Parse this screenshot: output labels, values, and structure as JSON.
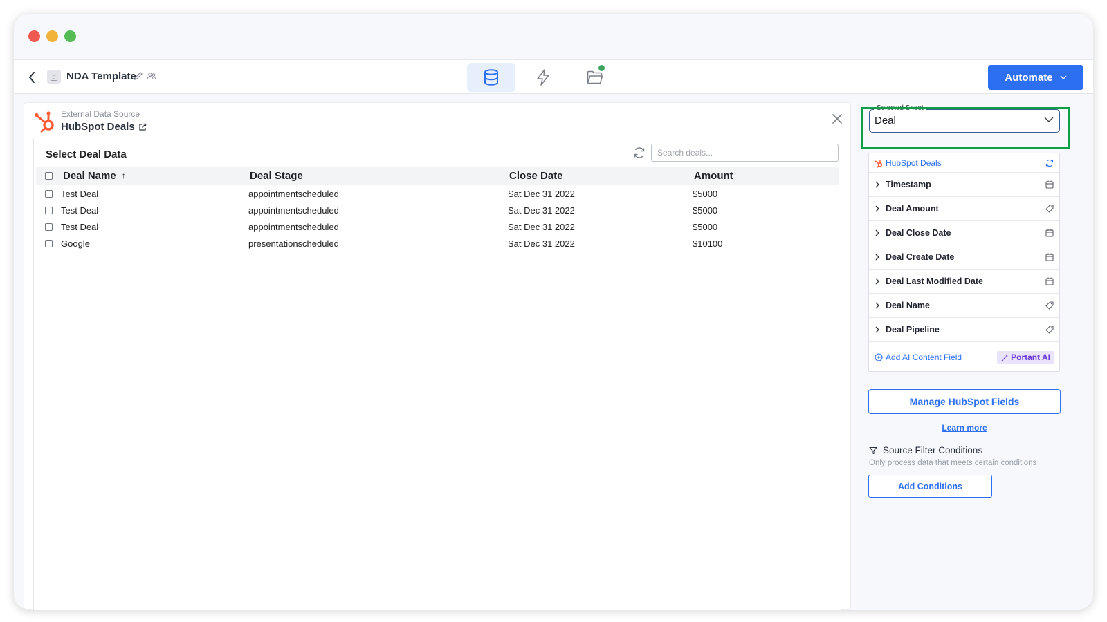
{
  "toolbar": {
    "doc_title": "NDA Template",
    "automate_label": "Automate",
    "tabs": [
      {
        "icon": "database-icon",
        "active": true
      },
      {
        "icon": "lightning-icon",
        "active": false
      },
      {
        "icon": "folder-icon",
        "active": false,
        "badge": true
      }
    ]
  },
  "source": {
    "label": "External Data Source",
    "name": "HubSpot Deals"
  },
  "table": {
    "title": "Select Deal Data",
    "search_placeholder": "Search deals...",
    "headers": {
      "name": "Deal Name",
      "sort_indicator": "↑",
      "stage": "Deal Stage",
      "close": "Close Date",
      "amount": "Amount"
    },
    "rows": [
      {
        "name": "Test Deal",
        "stage": "appointmentscheduled",
        "close": "Sat Dec 31 2022",
        "amount": "$5000"
      },
      {
        "name": "Test Deal",
        "stage": "appointmentscheduled",
        "close": "Sat Dec 31 2022",
        "amount": "$5000"
      },
      {
        "name": "Test Deal",
        "stage": "appointmentscheduled",
        "close": "Sat Dec 31 2022",
        "amount": "$5000"
      },
      {
        "name": "Google",
        "stage": "presentationscheduled",
        "close": "Sat Dec 31 2022",
        "amount": "$10100"
      }
    ]
  },
  "sidebar": {
    "sheet_label": "Selected Sheet",
    "sheet_value": "Deal",
    "fields_source": "HubSpot Deals",
    "fields": [
      {
        "name": "Timestamp",
        "icon": "calendar-icon"
      },
      {
        "name": "Deal Amount",
        "icon": "tag-icon"
      },
      {
        "name": "Deal Close Date",
        "icon": "calendar-icon"
      },
      {
        "name": "Deal Create Date",
        "icon": "calendar-icon"
      },
      {
        "name": "Deal Last Modified Date",
        "icon": "calendar-icon"
      },
      {
        "name": "Deal Name",
        "icon": "tag-icon"
      },
      {
        "name": "Deal Pipeline",
        "icon": "tag-icon"
      }
    ],
    "add_ai_label": "Add AI Content Field",
    "portant_ai_label": "Portant AI",
    "manage_label": "Manage HubSpot Fields",
    "learn_more": "Learn more",
    "filter_title": "Source Filter Conditions",
    "filter_desc": "Only process data that meets certain conditions",
    "add_conditions_label": "Add Conditions"
  },
  "colors": {
    "accent": "#2d6ff1",
    "highlight": "#0e9f48",
    "hubspot": "#ff5c35",
    "status_dot": "#3ba55d"
  }
}
